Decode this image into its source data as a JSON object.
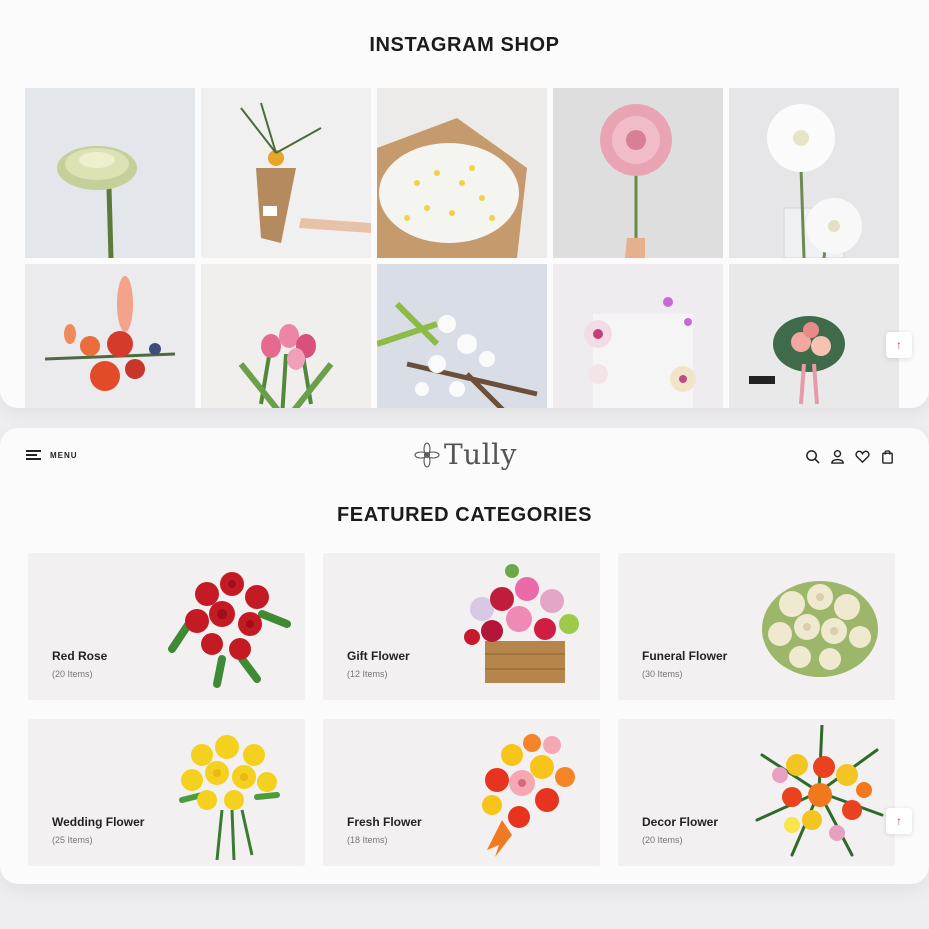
{
  "instagram": {
    "title": "INSTAGRAM SHOP",
    "tiles": [
      {
        "icon": "green-chrysanthemum-photo"
      },
      {
        "icon": "bouquet-in-hand-photo"
      },
      {
        "icon": "white-daisies-paper-wrap-photo"
      },
      {
        "icon": "pink-dahlia-photo"
      },
      {
        "icon": "white-dahlias-vase-photo"
      },
      {
        "icon": "mixed-red-bouquet-photo"
      },
      {
        "icon": "pink-tulips-photo"
      },
      {
        "icon": "white-blossom-branch-photo"
      },
      {
        "icon": "orchids-photo"
      },
      {
        "icon": "gift-bouquet-photo"
      }
    ]
  },
  "header": {
    "menu_label": "MENU",
    "logo_text": "Tully",
    "icons": [
      "search-icon",
      "user-icon",
      "heart-icon",
      "bag-icon"
    ]
  },
  "featured": {
    "title": "FEATURED CATEGORIES",
    "categories": [
      {
        "name": "Red Rose",
        "count": "(20 Items)"
      },
      {
        "name": "Gift Flower",
        "count": "(12 Items)"
      },
      {
        "name": "Funeral Flower",
        "count": "(30 Items)"
      },
      {
        "name": "Wedding Flower",
        "count": "(25 Items)"
      },
      {
        "name": "Fresh Flower",
        "count": "(18 Items)"
      },
      {
        "name": "Decor Flower",
        "count": "(20 Items)"
      }
    ]
  },
  "scroll_top_symbol": "↑",
  "colors": {
    "background": "#eeedef",
    "card": "#fcfbfc",
    "category_card": "#f3f0f1",
    "accent": "#c64a6a"
  }
}
